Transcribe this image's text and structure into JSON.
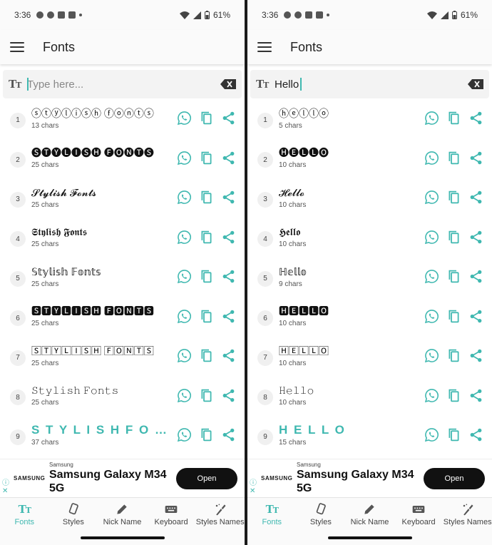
{
  "accent_color": "#3fb8b0",
  "screens": [
    {
      "status": {
        "time": "3:36",
        "battery": "61%"
      },
      "appbar": {
        "title": "Fonts"
      },
      "input": {
        "value": "",
        "placeholder": "Type here..."
      },
      "rows": [
        {
          "n": "1",
          "text": "ⓢⓣⓨⓛⓘⓢⓗ ⓕⓞⓝⓣⓢ",
          "chars": "13 chars"
        },
        {
          "n": "2",
          "text": "🅢🅣🅨🅛🅘🅢🅗 🅕🅞🅝🅣🅢",
          "chars": "25 chars"
        },
        {
          "n": "3",
          "text": "𝓢𝓽𝔂𝓵𝓲𝓼𝓱 𝓕𝓸𝓷𝓽𝓼",
          "chars": "25 chars"
        },
        {
          "n": "4",
          "text": "𝕾𝖙𝖞𝖑𝖎𝖘𝖍 𝕱𝖔𝖓𝖙𝖘",
          "chars": "25 chars"
        },
        {
          "n": "5",
          "text": "𝕊𝕥𝕪𝕝𝕚𝕤𝕙 𝔽𝕠𝕟𝕥𝕤",
          "chars": "25 chars"
        },
        {
          "n": "6",
          "text": "🆂🆃🆈🅻🅸🆂🅷 🅵🅾🅽🆃🆂",
          "chars": "25 chars"
        },
        {
          "n": "7",
          "text": "🅂🅃🅈🄻🄸🅂🄷 🄵🄾🄽🅃🅂",
          "chars": "25 chars"
        },
        {
          "n": "8",
          "text": "𝚂𝚝𝚢𝚕𝚒𝚜𝚑 𝙵𝚘𝚗𝚝𝚜",
          "chars": "25 chars"
        },
        {
          "n": "9",
          "text": "S T Y L I S H F O N T S",
          "chars": "37 chars"
        }
      ],
      "ad": {
        "brand": "Samsung",
        "logo": "SAMSUNG",
        "title": "Samsung Galaxy M34 5G",
        "button": "Open"
      }
    },
    {
      "status": {
        "time": "3:36",
        "battery": "61%"
      },
      "appbar": {
        "title": "Fonts"
      },
      "input": {
        "value": "Hello",
        "placeholder": "Type here..."
      },
      "rows": [
        {
          "n": "1",
          "text": "ⓗⓔⓛⓛⓞ",
          "chars": "5 chars"
        },
        {
          "n": "2",
          "text": "🅗🅔🅛🅛🅞",
          "chars": "10 chars"
        },
        {
          "n": "3",
          "text": "𝓗𝓮𝓵𝓵𝓸",
          "chars": "10 chars"
        },
        {
          "n": "4",
          "text": "𝕳𝖊𝖑𝖑𝖔",
          "chars": "10 chars"
        },
        {
          "n": "5",
          "text": "ℍ𝕖𝕝𝕝𝕠",
          "chars": "9 chars"
        },
        {
          "n": "6",
          "text": "🅷🅴🅻🅻🅾",
          "chars": "10 chars"
        },
        {
          "n": "7",
          "text": "🄷🄴🄻🄻🄾",
          "chars": "10 chars"
        },
        {
          "n": "8",
          "text": "𝙷𝚎𝚕𝚕𝚘",
          "chars": "10 chars"
        },
        {
          "n": "9",
          "text": "H E L L O",
          "chars": "15 chars"
        }
      ],
      "ad": {
        "brand": "Samsung",
        "logo": "SAMSUNG",
        "title": "Samsung Galaxy M34 5G",
        "button": "Open"
      }
    }
  ],
  "nav": [
    {
      "label": "Fonts",
      "icon": "text-size-icon",
      "active": true
    },
    {
      "label": "Styles",
      "icon": "brush-icon",
      "active": false
    },
    {
      "label": "Nick Name",
      "icon": "pencil-icon",
      "active": false
    },
    {
      "label": "Keyboard",
      "icon": "keyboard-icon",
      "active": false
    },
    {
      "label": "Styles Names",
      "icon": "magic-brush-icon",
      "active": false
    }
  ]
}
